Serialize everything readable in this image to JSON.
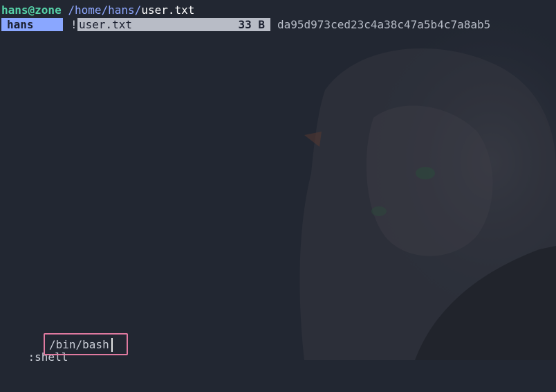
{
  "prompt": {
    "user_host": "hans@zone",
    "path_dir": "/home/hans/",
    "path_file": "user.txt"
  },
  "tab": {
    "label": "hans"
  },
  "file_row": {
    "marker": "!",
    "name": "user.txt",
    "size": "33 B",
    "preview": "da95d973ced23c4a38c47a5b4c7a8ab5"
  },
  "command": {
    "label": ":shell",
    "value": "/bin/bash"
  },
  "colors": {
    "background": "#222732",
    "user": "#56d1a8",
    "path": "#8fa8ff",
    "tab_bg": "#8aa7ff",
    "selection_bg": "#b8bcc6",
    "input_border": "#e07aa0"
  }
}
